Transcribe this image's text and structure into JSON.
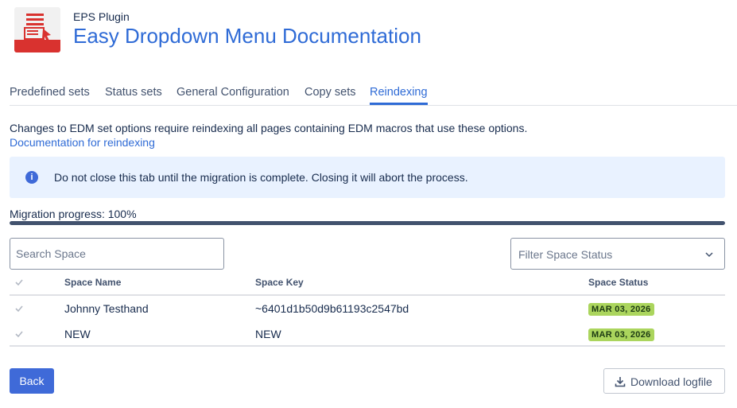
{
  "header": {
    "plugin_label": "EPS Plugin",
    "title": "Easy Dropdown Menu Documentation"
  },
  "tabs": [
    {
      "label": "Predefined sets",
      "active": false
    },
    {
      "label": "Status sets",
      "active": false
    },
    {
      "label": "General Configuration",
      "active": false
    },
    {
      "label": "Copy sets",
      "active": false
    },
    {
      "label": "Reindexing",
      "active": true
    }
  ],
  "intro": {
    "text": "Changes to EDM set options require reindexing all pages containing EDM macros that use these options.",
    "link": "Documentation for reindexing"
  },
  "notice": {
    "icon": "info-icon",
    "text": "Do not close this tab until the migration is complete. Closing it will abort the process."
  },
  "progress": {
    "label": "Migration progress: 100%",
    "value": 100
  },
  "search": {
    "placeholder": "Search Space",
    "value": ""
  },
  "filter": {
    "placeholder": "Filter Space Status"
  },
  "table": {
    "columns": [
      "Space Name",
      "Space Key",
      "Space Status"
    ],
    "rows": [
      {
        "name": "Johnny Testhand",
        "key": "~6401d1b50d9b61193c2547bd",
        "status": "MAR 03, 2026"
      },
      {
        "name": "NEW",
        "key": "NEW",
        "status": "MAR 03, 2026"
      }
    ]
  },
  "buttons": {
    "back": "Back",
    "download": "Download logfile"
  },
  "colors": {
    "accent": "#2f6bd6",
    "primary_button": "#3f6ad8",
    "notice_bg": "#e9f2ff",
    "progress_fill": "#42526e",
    "status_badge": "#abd55d"
  }
}
